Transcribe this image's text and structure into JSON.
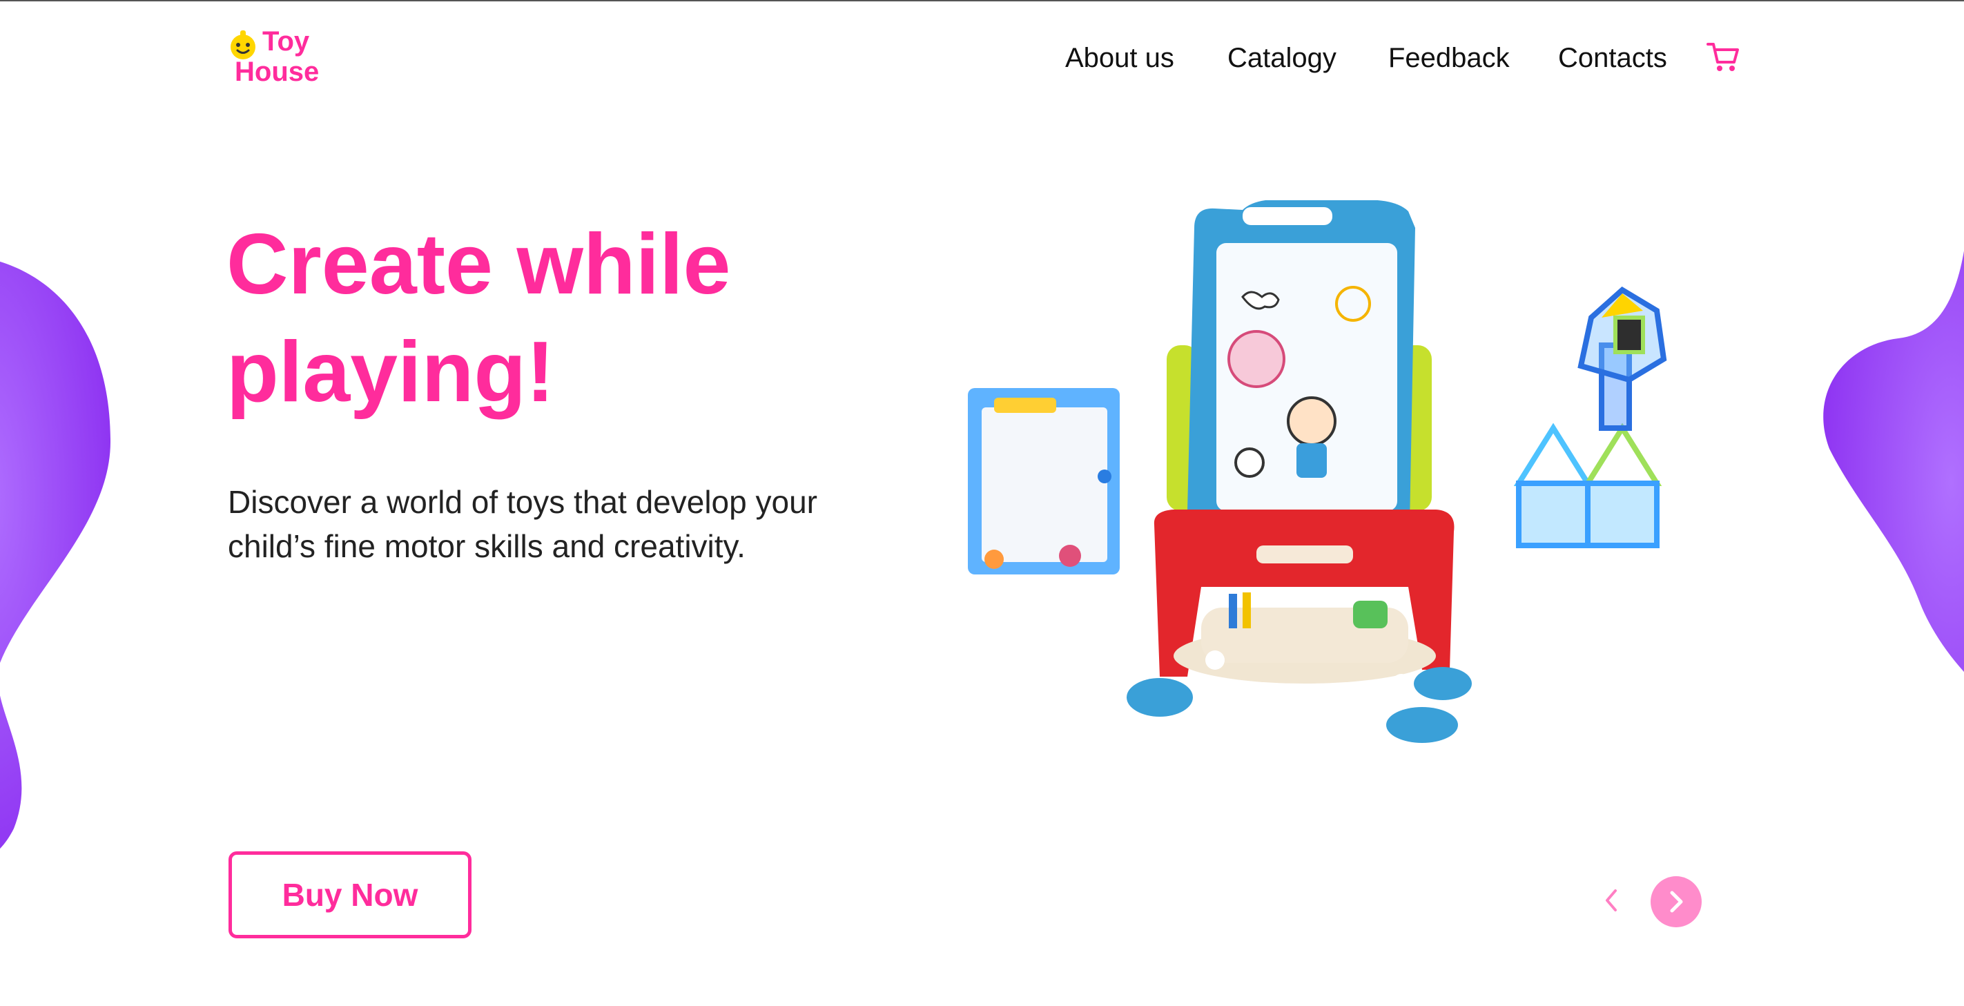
{
  "brand": {
    "name_line1": "Toy",
    "name_line2": "House"
  },
  "nav": {
    "items": [
      "About us",
      "Catalogy",
      "Feedback",
      "Contacts"
    ]
  },
  "hero": {
    "title_line1": "Create while",
    "title_line2": "playing!",
    "subtitle_line1": "Discover a world of toys that develop your",
    "subtitle_line2": "child’s fine motor skills and creativity.",
    "buy_label": "Buy Now"
  },
  "icons": {
    "logo": "smiling-face-icon",
    "cart": "shopping-cart-icon",
    "prev": "chevron-left-icon",
    "next": "chevron-right-icon"
  },
  "colors": {
    "accent": "#ff2c9c",
    "accent_light": "#ff8ccb",
    "blob": "#9b3df5",
    "logo_yellow": "#ffd600"
  }
}
